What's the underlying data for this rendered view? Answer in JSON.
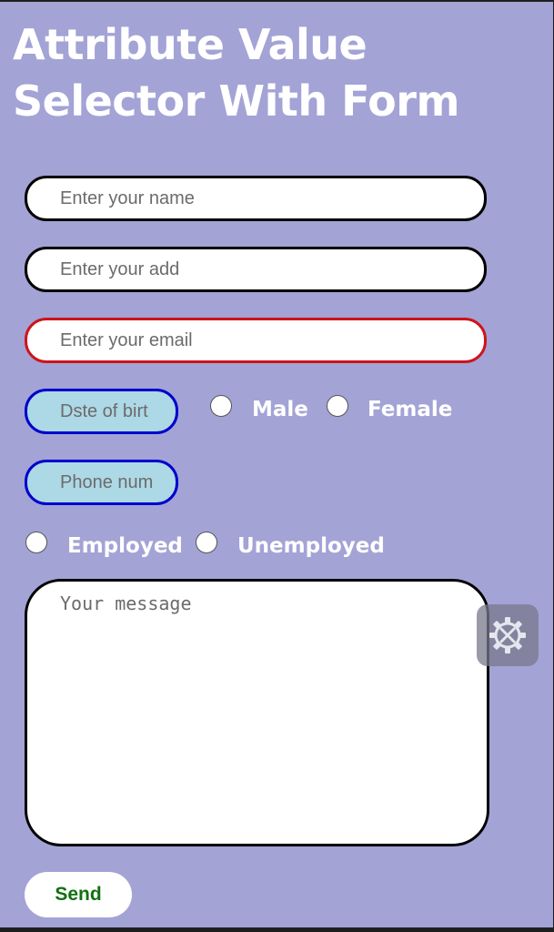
{
  "page": {
    "title": "Attribute Value Selector With Form"
  },
  "form": {
    "name_placeholder": "Enter your name",
    "address_placeholder": "Enter your add",
    "email_placeholder": "Enter your email",
    "dob_placeholder": "Dste of birt",
    "phone_placeholder": "Phone num",
    "gender": {
      "options": [
        "Male",
        "Female"
      ]
    },
    "employment": {
      "options": [
        "Employed",
        "Unemployed"
      ]
    },
    "message_placeholder": "Your message",
    "send_label": "Send"
  },
  "overlay": {
    "settings_icon": "gear-tools-icon"
  },
  "colors": {
    "background": "#a3a3d6",
    "email_border": "#d0121a",
    "small_field_border": "#0000cd",
    "small_field_fill": "#add8e6",
    "send_text": "#107010"
  }
}
